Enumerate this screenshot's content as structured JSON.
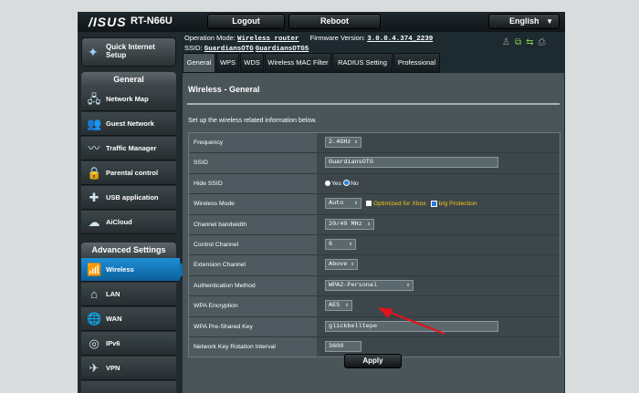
{
  "header": {
    "logo": "/ISUS",
    "model": "RT-N66U",
    "logout": "Logout",
    "reboot": "Reboot",
    "language": "English"
  },
  "status": {
    "op_mode_label": "Operation Mode:",
    "op_mode_value": "Wireless router",
    "fw_label": "Firmware Version:",
    "fw_value": "3.0.0.4.374_2239",
    "ssid_label": "SSID:",
    "ssid_1": "GuardiansOTG",
    "ssid_2": "GuardiansOTG5"
  },
  "sidebar": {
    "quick_setup": "Quick Internet Setup",
    "general_title": "General",
    "general_items": [
      {
        "label": "Network Map",
        "icon": "network-map-icon"
      },
      {
        "label": "Guest Network",
        "icon": "guest-network-icon"
      },
      {
        "label": "Traffic Manager",
        "icon": "traffic-manager-icon"
      },
      {
        "label": "Parental control",
        "icon": "lock-icon"
      },
      {
        "label": "USB application",
        "icon": "usb-app-icon"
      },
      {
        "label": "AiCloud",
        "icon": "cloud-icon"
      }
    ],
    "advanced_title": "Advanced Settings",
    "advanced_items": [
      {
        "label": "Wireless",
        "icon": "wireless-icon"
      },
      {
        "label": "LAN",
        "icon": "lan-icon"
      },
      {
        "label": "WAN",
        "icon": "wan-icon"
      },
      {
        "label": "IPv6",
        "icon": "ipv6-icon"
      },
      {
        "label": "VPN",
        "icon": "vpn-icon"
      }
    ]
  },
  "tabs": [
    "General",
    "WPS",
    "WDS",
    "Wireless MAC Filter",
    "RADIUS Setting",
    "Professional"
  ],
  "content": {
    "title": "Wireless - General",
    "description": "Set up the wireless related information below."
  },
  "form": {
    "frequency": {
      "label": "Frequency",
      "value": "2.4GHz"
    },
    "ssid": {
      "label": "SSID",
      "value": "GuardiansOTG"
    },
    "hide_ssid": {
      "label": "Hide SSID",
      "yes": "Yes",
      "no": "No"
    },
    "wireless_mode": {
      "label": "Wireless Mode",
      "value": "Auto",
      "xbox": "Optimized for Xbox",
      "bg": "b/g Protection"
    },
    "channel_bandwidth": {
      "label": "Channel bandwidth",
      "value": "20/40 MHz"
    },
    "control_channel": {
      "label": "Control Channel",
      "value": "6"
    },
    "extension_channel": {
      "label": "Extension Channel",
      "value": "Above"
    },
    "auth_method": {
      "label": "Authentication Method",
      "value": "WPA2-Personal"
    },
    "wpa_encryption": {
      "label": "WPA Encryption",
      "value": "AES"
    },
    "wpa_key": {
      "label": "WPA Pre-Shared Key",
      "value": "glickbelltepe"
    },
    "rotation": {
      "label": "Network Key Rotation Interval",
      "value": "3600"
    }
  },
  "apply_label": "Apply",
  "colors": {
    "accent": "#1e8fd6",
    "arrow": "#e0141b",
    "xbox_text": "#f0c419"
  }
}
